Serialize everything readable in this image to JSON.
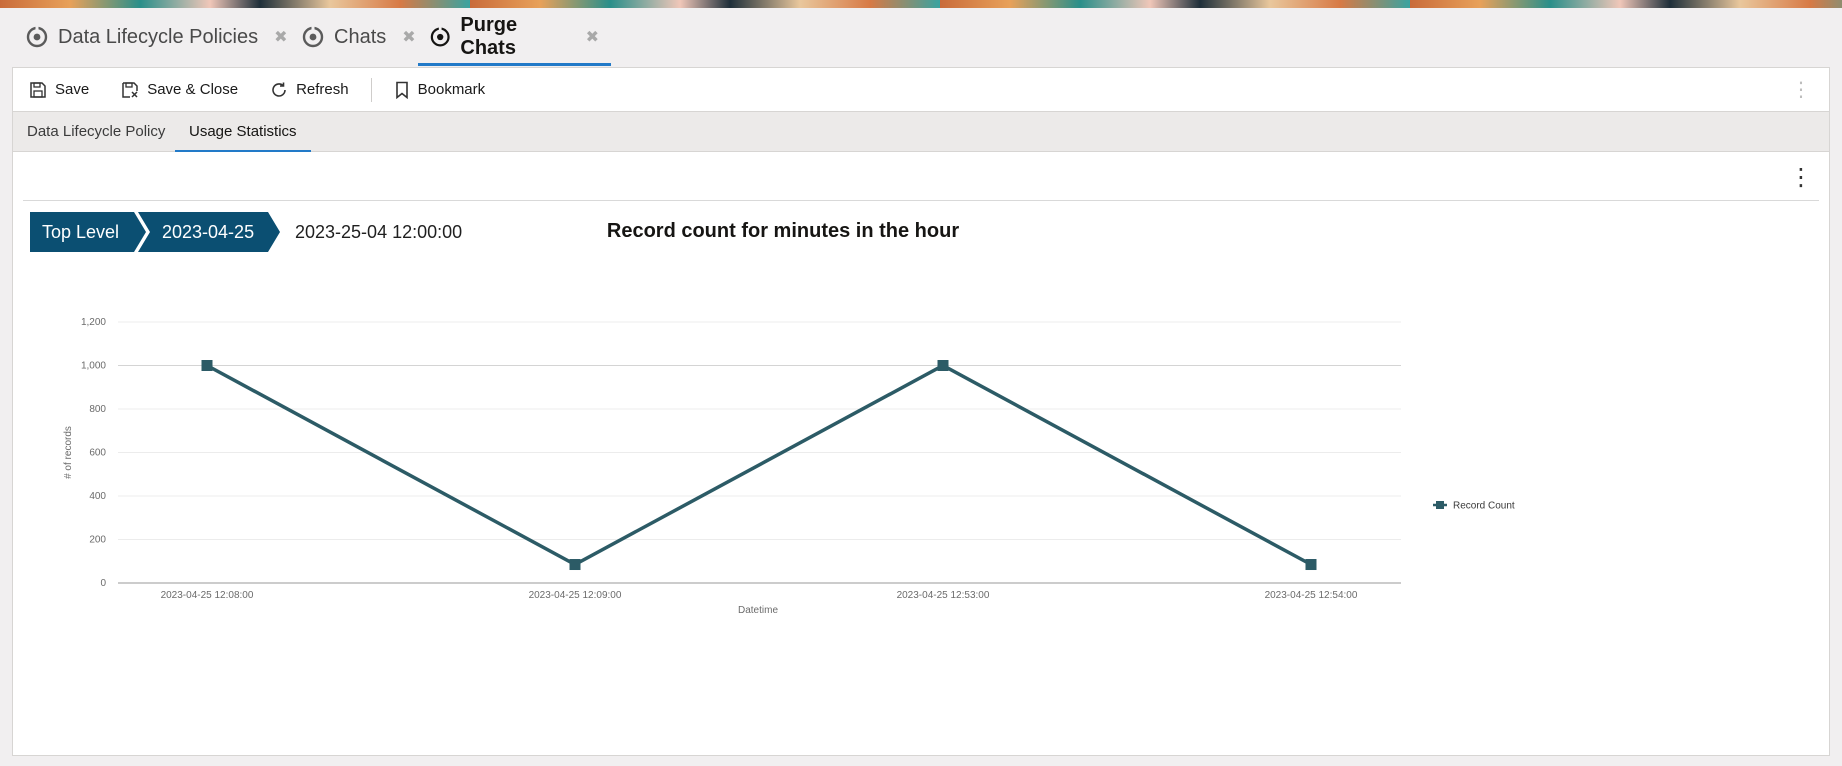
{
  "doc_tabs": [
    {
      "label": "Data Lifecycle Policies",
      "active": false
    },
    {
      "label": "Chats",
      "active": false
    },
    {
      "label": "Purge Chats",
      "active": true
    }
  ],
  "toolbar": {
    "save": "Save",
    "save_close": "Save & Close",
    "refresh": "Refresh",
    "bookmark": "Bookmark"
  },
  "sub_tabs": [
    {
      "label": "Data Lifecycle Policy",
      "active": false
    },
    {
      "label": "Usage Statistics",
      "active": true
    }
  ],
  "breadcrumb": {
    "level1": "Top Level",
    "level2": "2023-04-25",
    "current": "2023-25-04 12:00:00"
  },
  "colors": {
    "accent": "#227ac8",
    "breadcrumb": "#0b4f72",
    "series": "#2c5b66"
  },
  "chart_data": {
    "type": "line",
    "title": "Record count for minutes in the hour",
    "xlabel": "Datetime",
    "ylabel": "# of records",
    "categories": [
      "2023-04-25 12:08:00",
      "2023-04-25 12:09:00",
      "2023-04-25 12:53:00",
      "2023-04-25 12:54:00"
    ],
    "series": [
      {
        "name": "Record Count",
        "values": [
          1000,
          85,
          1000,
          85
        ]
      }
    ],
    "ylim": [
      0,
      1200
    ],
    "yticks": [
      0,
      200,
      400,
      600,
      800,
      1000,
      1200
    ],
    "ytick_labels": [
      "0",
      "200",
      "400",
      "600",
      "800",
      "1,000",
      "1,200"
    ],
    "grid": true,
    "legend": "right"
  }
}
